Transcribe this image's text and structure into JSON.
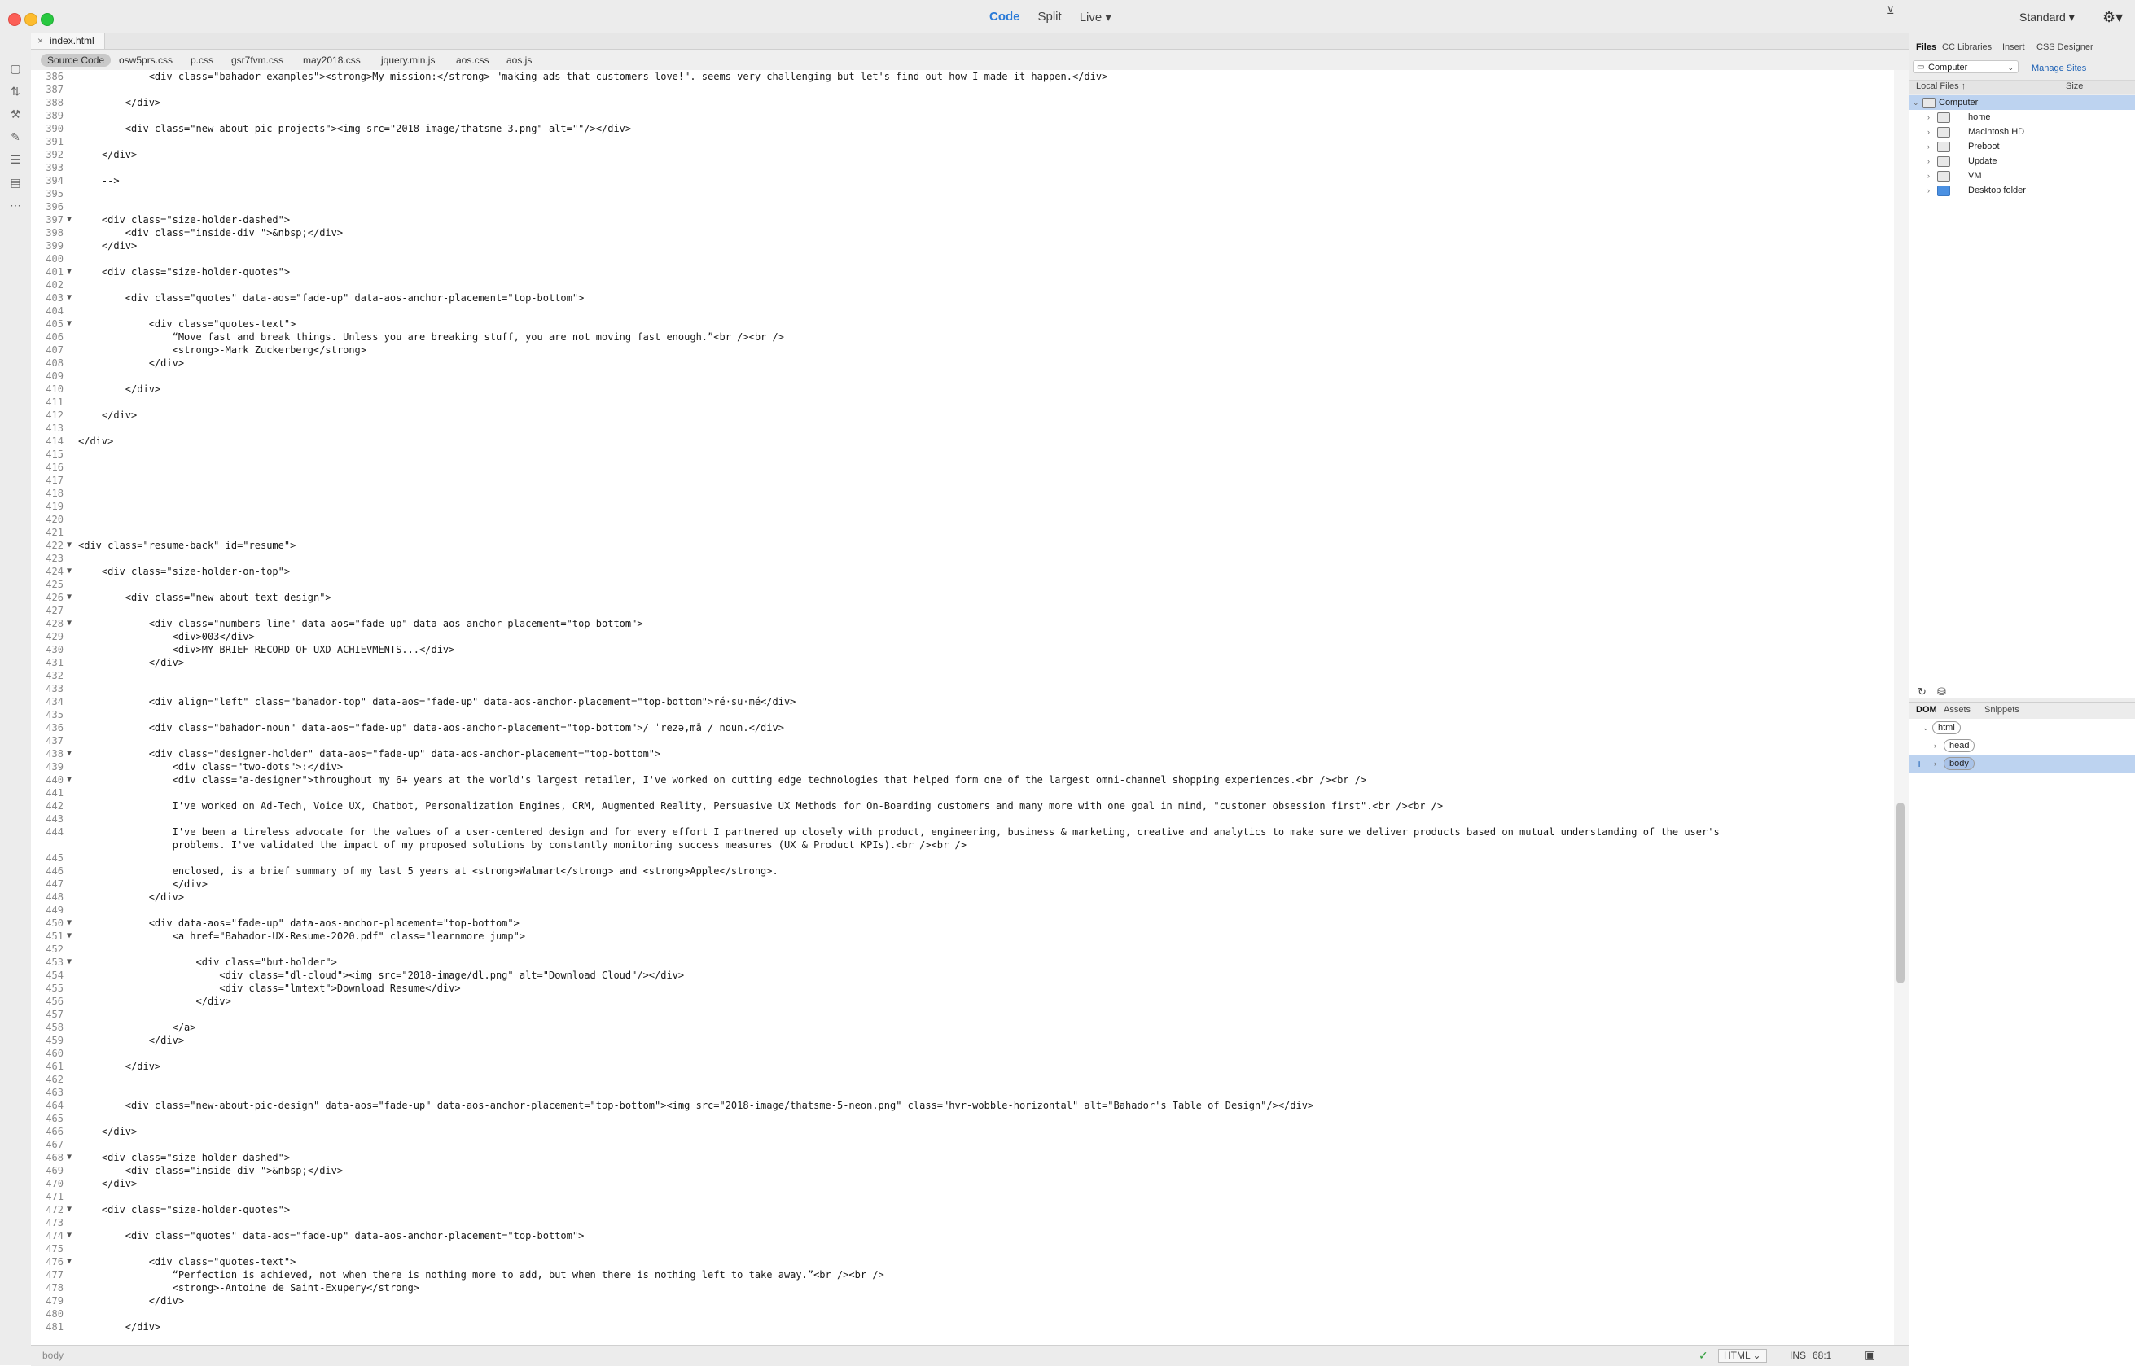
{
  "titlebar": {
    "modes": {
      "code": "Code",
      "split": "Split",
      "live": "Live"
    },
    "live_caret": "▾",
    "workspace": "Standard ▾",
    "gear": "⚙▾"
  },
  "colors": {
    "accent": "#2b7bd8",
    "selection": "#bdd3f0",
    "ok_green": "#2e9c3a"
  },
  "left_tools": [
    "file-icon",
    "git-icon",
    "wand-icon",
    "brush-icon",
    "chat-icon",
    "snippet-icon",
    "more-icon"
  ],
  "document": {
    "tab_close": "×",
    "tab": "index.html"
  },
  "related_files": [
    "Source Code",
    "osw5prs.css",
    "p.css",
    "gsr7fvm.css",
    "may2018.css",
    "jquery.min.js",
    "aos.css",
    "aos.js"
  ],
  "filter_glyph": "⊻",
  "code": [
    {
      "n": "386",
      "f": "",
      "t": "            <div class=\"bahador-examples\"><strong>My mission:</strong> \"making ads that customers love!\". seems very challenging but let's find out how I made it happen.</div>"
    },
    {
      "n": "387",
      "f": "",
      "t": ""
    },
    {
      "n": "388",
      "f": "",
      "t": "        </div>"
    },
    {
      "n": "389",
      "f": "",
      "t": ""
    },
    {
      "n": "390",
      "f": "",
      "t": "        <div class=\"new-about-pic-projects\"><img src=\"2018-image/thatsme-3.png\" alt=\"\"/></div>"
    },
    {
      "n": "391",
      "f": "",
      "t": ""
    },
    {
      "n": "392",
      "f": "",
      "t": "    </div>"
    },
    {
      "n": "393",
      "f": "",
      "t": ""
    },
    {
      "n": "394",
      "f": "",
      "t": "    -->"
    },
    {
      "n": "395",
      "f": "",
      "t": ""
    },
    {
      "n": "396",
      "f": "",
      "t": ""
    },
    {
      "n": "397",
      "f": "▼",
      "t": "    <div class=\"size-holder-dashed\">"
    },
    {
      "n": "398",
      "f": "",
      "t": "        <div class=\"inside-div \">&nbsp;</div>"
    },
    {
      "n": "399",
      "f": "",
      "t": "    </div>"
    },
    {
      "n": "400",
      "f": "",
      "t": ""
    },
    {
      "n": "401",
      "f": "▼",
      "t": "    <div class=\"size-holder-quotes\">"
    },
    {
      "n": "402",
      "f": "",
      "t": ""
    },
    {
      "n": "403",
      "f": "▼",
      "t": "        <div class=\"quotes\" data-aos=\"fade-up\" data-aos-anchor-placement=\"top-bottom\">"
    },
    {
      "n": "404",
      "f": "",
      "t": ""
    },
    {
      "n": "405",
      "f": "▼",
      "t": "            <div class=\"quotes-text\">"
    },
    {
      "n": "406",
      "f": "",
      "t": "                “Move fast and break things. Unless you are breaking stuff, you are not moving fast enough.”<br /><br />"
    },
    {
      "n": "407",
      "f": "",
      "t": "                <strong>-Mark Zuckerberg</strong>"
    },
    {
      "n": "408",
      "f": "",
      "t": "            </div>"
    },
    {
      "n": "409",
      "f": "",
      "t": ""
    },
    {
      "n": "410",
      "f": "",
      "t": "        </div>"
    },
    {
      "n": "411",
      "f": "",
      "t": ""
    },
    {
      "n": "412",
      "f": "",
      "t": "    </div>"
    },
    {
      "n": "413",
      "f": "",
      "t": ""
    },
    {
      "n": "414",
      "f": "",
      "t": "</div>"
    },
    {
      "n": "415",
      "f": "",
      "t": ""
    },
    {
      "n": "416",
      "f": "",
      "t": ""
    },
    {
      "n": "417",
      "f": "",
      "t": ""
    },
    {
      "n": "418",
      "f": "",
      "t": ""
    },
    {
      "n": "419",
      "f": "",
      "t": ""
    },
    {
      "n": "420",
      "f": "",
      "t": ""
    },
    {
      "n": "421",
      "f": "",
      "t": ""
    },
    {
      "n": "422",
      "f": "▼",
      "t": "<div class=\"resume-back\" id=\"resume\">"
    },
    {
      "n": "423",
      "f": "",
      "t": ""
    },
    {
      "n": "424",
      "f": "▼",
      "t": "    <div class=\"size-holder-on-top\">"
    },
    {
      "n": "425",
      "f": "",
      "t": ""
    },
    {
      "n": "426",
      "f": "▼",
      "t": "        <div class=\"new-about-text-design\">"
    },
    {
      "n": "427",
      "f": "",
      "t": ""
    },
    {
      "n": "428",
      "f": "▼",
      "t": "            <div class=\"numbers-line\" data-aos=\"fade-up\" data-aos-anchor-placement=\"top-bottom\">"
    },
    {
      "n": "429",
      "f": "",
      "t": "                <div>003</div>"
    },
    {
      "n": "430",
      "f": "",
      "t": "                <div>MY BRIEF RECORD OF UXD ACHIEVMENTS...</div>"
    },
    {
      "n": "431",
      "f": "",
      "t": "            </div>"
    },
    {
      "n": "432",
      "f": "",
      "t": ""
    },
    {
      "n": "433",
      "f": "",
      "t": ""
    },
    {
      "n": "434",
      "f": "",
      "t": "            <div align=\"left\" class=\"bahador-top\" data-aos=\"fade-up\" data-aos-anchor-placement=\"top-bottom\">ré·su·mé</div>"
    },
    {
      "n": "435",
      "f": "",
      "t": ""
    },
    {
      "n": "436",
      "f": "",
      "t": "            <div class=\"bahador-noun\" data-aos=\"fade-up\" data-aos-anchor-placement=\"top-bottom\">/ ˈrezə,mā / noun.</div>"
    },
    {
      "n": "437",
      "f": "",
      "t": ""
    },
    {
      "n": "438",
      "f": "▼",
      "t": "            <div class=\"designer-holder\" data-aos=\"fade-up\" data-aos-anchor-placement=\"top-bottom\">"
    },
    {
      "n": "439",
      "f": "",
      "t": "                <div class=\"two-dots\">:</div>"
    },
    {
      "n": "440",
      "f": "▼",
      "t": "                <div class=\"a-designer\">throughout my 6+ years at the world's largest retailer, I've worked on cutting edge technologies that helped form one of the largest omni-channel shopping experiences.<br /><br />"
    },
    {
      "n": "441",
      "f": "",
      "t": ""
    },
    {
      "n": "442",
      "f": "",
      "t": "                I've worked on Ad-Tech, Voice UX, Chatbot, Personalization Engines, CRM, Augmented Reality, Persuasive UX Methods for On-Boarding customers and many more with one goal in mind, \"customer obsession first\".<br /><br />"
    },
    {
      "n": "443",
      "f": "",
      "t": ""
    },
    {
      "n": "444",
      "f": "",
      "t": "                I've been a tireless advocate for the values of a user-centered design and for every effort I partnered up closely with product, engineering, business & marketing, creative and analytics to make sure we deliver products based on mutual understanding of the user's"
    },
    {
      "n": "",
      "f": "",
      "t": "                problems. I've validated the impact of my proposed solutions by constantly monitoring success measures (UX & Product KPIs).<br /><br />"
    },
    {
      "n": "445",
      "f": "",
      "t": ""
    },
    {
      "n": "446",
      "f": "",
      "t": "                enclosed, is a brief summary of my last 5 years at <strong>Walmart</strong> and <strong>Apple</strong>."
    },
    {
      "n": "447",
      "f": "",
      "t": "                </div>"
    },
    {
      "n": "448",
      "f": "",
      "t": "            </div>"
    },
    {
      "n": "449",
      "f": "",
      "t": ""
    },
    {
      "n": "450",
      "f": "▼",
      "t": "            <div data-aos=\"fade-up\" data-aos-anchor-placement=\"top-bottom\">"
    },
    {
      "n": "451",
      "f": "▼",
      "t": "                <a href=\"Bahador-UX-Resume-2020.pdf\" class=\"learnmore jump\">"
    },
    {
      "n": "452",
      "f": "",
      "t": ""
    },
    {
      "n": "453",
      "f": "▼",
      "t": "                    <div class=\"but-holder\">"
    },
    {
      "n": "454",
      "f": "",
      "t": "                        <div class=\"dl-cloud\"><img src=\"2018-image/dl.png\" alt=\"Download Cloud\"/></div>"
    },
    {
      "n": "455",
      "f": "",
      "t": "                        <div class=\"lmtext\">Download Resume</div>"
    },
    {
      "n": "456",
      "f": "",
      "t": "                    </div>"
    },
    {
      "n": "457",
      "f": "",
      "t": ""
    },
    {
      "n": "458",
      "f": "",
      "t": "                </a>"
    },
    {
      "n": "459",
      "f": "",
      "t": "            </div>"
    },
    {
      "n": "460",
      "f": "",
      "t": ""
    },
    {
      "n": "461",
      "f": "",
      "t": "        </div>"
    },
    {
      "n": "462",
      "f": "",
      "t": ""
    },
    {
      "n": "463",
      "f": "",
      "t": ""
    },
    {
      "n": "464",
      "f": "",
      "t": "        <div class=\"new-about-pic-design\" data-aos=\"fade-up\" data-aos-anchor-placement=\"top-bottom\"><img src=\"2018-image/thatsme-5-neon.png\" class=\"hvr-wobble-horizontal\" alt=\"Bahador's Table of Design\"/></div>"
    },
    {
      "n": "465",
      "f": "",
      "t": ""
    },
    {
      "n": "466",
      "f": "",
      "t": "    </div>"
    },
    {
      "n": "467",
      "f": "",
      "t": ""
    },
    {
      "n": "468",
      "f": "▼",
      "t": "    <div class=\"size-holder-dashed\">"
    },
    {
      "n": "469",
      "f": "",
      "t": "        <div class=\"inside-div \">&nbsp;</div>"
    },
    {
      "n": "470",
      "f": "",
      "t": "    </div>"
    },
    {
      "n": "471",
      "f": "",
      "t": ""
    },
    {
      "n": "472",
      "f": "▼",
      "t": "    <div class=\"size-holder-quotes\">"
    },
    {
      "n": "473",
      "f": "",
      "t": ""
    },
    {
      "n": "474",
      "f": "▼",
      "t": "        <div class=\"quotes\" data-aos=\"fade-up\" data-aos-anchor-placement=\"top-bottom\">"
    },
    {
      "n": "475",
      "f": "",
      "t": ""
    },
    {
      "n": "476",
      "f": "▼",
      "t": "            <div class=\"quotes-text\">"
    },
    {
      "n": "477",
      "f": "",
      "t": "                “Perfection is achieved, not when there is nothing more to add, but when there is nothing left to take away.”<br /><br />"
    },
    {
      "n": "478",
      "f": "",
      "t": "                <strong>-Antoine de Saint-Exupery</strong>"
    },
    {
      "n": "479",
      "f": "",
      "t": "            </div>"
    },
    {
      "n": "480",
      "f": "",
      "t": ""
    },
    {
      "n": "481",
      "f": "",
      "t": "        </div>"
    }
  ],
  "status": {
    "tag": "body",
    "ok": "✓",
    "language": "HTML ⌄",
    "ins": "INS",
    "position": "68:1",
    "preview_glyph": "▣"
  },
  "panel": {
    "tabs": [
      "Files",
      "CC Libraries",
      "Insert",
      "CSS Designer"
    ],
    "location": "Computer",
    "location_caret": "⌄",
    "manage": "Manage Sites",
    "col_local": "Local Files ↑",
    "col_size": "Size",
    "tree": [
      {
        "label": "Computer",
        "caret": "⌄"
      },
      {
        "label": "home",
        "caret": "›"
      },
      {
        "label": "Macintosh HD",
        "caret": "›"
      },
      {
        "label": "Preboot",
        "caret": "›"
      },
      {
        "label": "Update",
        "caret": "›"
      },
      {
        "label": "VM",
        "caret": "›"
      },
      {
        "label": "Desktop folder",
        "caret": "›"
      }
    ],
    "refresh": "↻",
    "connect": "⛁",
    "dom_tabs": [
      "DOM",
      "Assets",
      "Snippets"
    ],
    "dom_tree": [
      {
        "label": "html",
        "caret": "⌄"
      },
      {
        "label": "head",
        "caret": "›"
      },
      {
        "label": "body",
        "caret": "›"
      }
    ],
    "add": "+"
  }
}
